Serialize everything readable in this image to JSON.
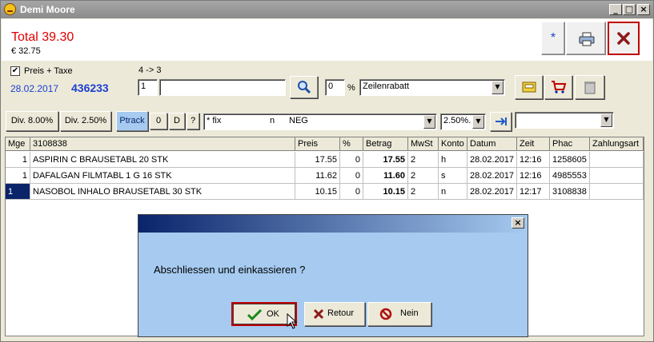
{
  "window": {
    "title": "Demi Moore",
    "btn_min": "_",
    "btn_max": "□",
    "btn_close": "×"
  },
  "header": {
    "total": "Total 39.30",
    "euro": "€ 32.75",
    "star_label": "*",
    "cancel_icon": "x-icon"
  },
  "row1": {
    "checkbox_label": "Preis + Taxe",
    "checked": true,
    "check_mark": "✔",
    "arrow_text": "4 -> 3",
    "date": "28.02.2017",
    "code": "436233",
    "qty": "1",
    "article": "",
    "percent_value": "0",
    "percent_sign": "%",
    "discount_type": "Zeilenrabatt"
  },
  "row2": {
    "div1": "Div. 8.00%",
    "div2": "Div. 2.50%",
    "ptrack": "Ptrack",
    "zero": "0",
    "d": "D",
    "q": "?",
    "fix": "* fix",
    "n": "n",
    "neg": "NEG",
    "vat": "2.50%.",
    "extra": ""
  },
  "grid": {
    "headers": [
      "Mge",
      "3108838",
      "Preis",
      "%",
      "Betrag",
      "MwSt",
      "Konto",
      "Datum",
      "Zeit",
      "Phac",
      "Zahlungsart"
    ],
    "rows": [
      {
        "mge": "1",
        "name": "ASPIRIN C BRAUSETABL 20 STK",
        "preis": "17.55",
        "pct": "0",
        "betrag": "17.55",
        "mwst": "2",
        "konto": "h",
        "datum": "28.02.2017",
        "zeit": "12:16",
        "phac": "1258605",
        "zahl": ""
      },
      {
        "mge": "1",
        "name": "DAFALGAN FILMTABL 1 G 16 STK",
        "preis": "11.62",
        "pct": "0",
        "betrag": "11.60",
        "mwst": "2",
        "konto": "s",
        "datum": "28.02.2017",
        "zeit": "12:16",
        "phac": "4985553",
        "zahl": ""
      },
      {
        "mge": "1",
        "name": "NASOBOL INHALO BRAUSETABL 30 STK",
        "preis": "10.15",
        "pct": "0",
        "betrag": "10.15",
        "mwst": "2",
        "konto": "n",
        "datum": "28.02.2017",
        "zeit": "12:17",
        "phac": "3108838",
        "zahl": ""
      }
    ]
  },
  "dialog": {
    "close": "×",
    "message": "Abschliessen und einkassieren ?",
    "ok": "OK",
    "retour": "Retour",
    "nein": "Nein"
  },
  "colors": {
    "accent_red": "#e00000",
    "blue_text": "#1a3fd0",
    "selection": "#0a246a",
    "dialog_bg": "#a6caf0"
  }
}
